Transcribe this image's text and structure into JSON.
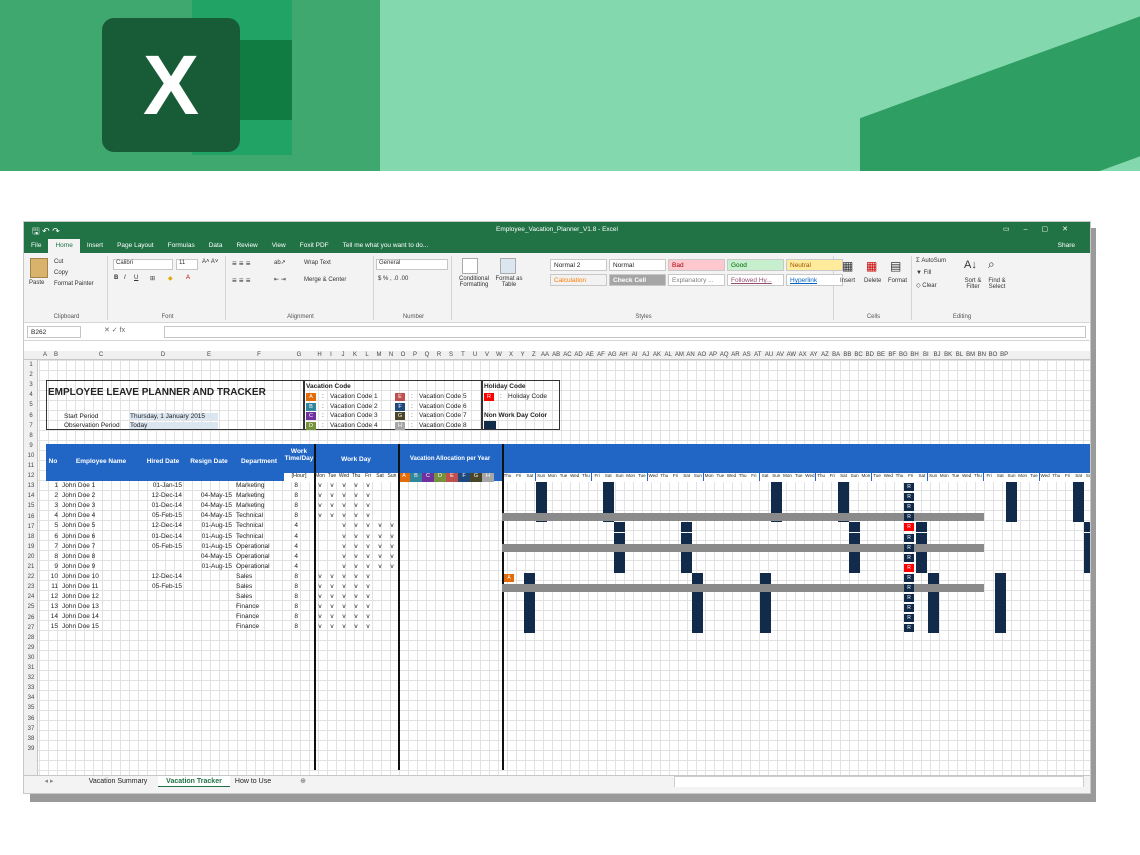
{
  "window": {
    "title": "Employee_Vacation_Planner_V1.8 - Excel",
    "share": "Share"
  },
  "tabs": [
    "File",
    "Home",
    "Insert",
    "Page Layout",
    "Formulas",
    "Data",
    "Review",
    "View",
    "Foxit PDF",
    "Tell me what you want to do..."
  ],
  "ribbon": {
    "clipboard": {
      "paste": "Paste",
      "cut": "Cut",
      "copy": "Copy",
      "format_painter": "Format Painter",
      "label": "Clipboard"
    },
    "font": {
      "name": "Calibri",
      "size": "11",
      "label": "Font"
    },
    "alignment": {
      "wrap": "Wrap Text",
      "merge": "Merge & Center",
      "label": "Alignment"
    },
    "number": {
      "format": "General",
      "label": "Number"
    },
    "styles": {
      "conditional": "Conditional Formatting",
      "format_table": "Format as Table",
      "label": "Styles",
      "cells": [
        {
          "text": "Normal 2",
          "bg": "#ffffff",
          "fg": "#222222"
        },
        {
          "text": "Normal",
          "bg": "#ffffff",
          "fg": "#222222"
        },
        {
          "text": "Bad",
          "bg": "#ffc7ce",
          "fg": "#9c0006"
        },
        {
          "text": "Good",
          "bg": "#c6efce",
          "fg": "#006100"
        },
        {
          "text": "Neutral",
          "bg": "#ffeb9c",
          "fg": "#9c5700"
        },
        {
          "text": "Calculation",
          "bg": "#f2f2f2",
          "fg": "#fa7d00"
        },
        {
          "text": "Check Cell",
          "bg": "#a5a5a5",
          "fg": "#ffffff"
        },
        {
          "text": "Explanatory ...",
          "bg": "#ffffff",
          "fg": "#7f7f7f"
        },
        {
          "text": "Followed Hy...",
          "bg": "#ffffff",
          "fg": "#954f72"
        },
        {
          "text": "Hyperlink",
          "bg": "#ffffff",
          "fg": "#0563c1"
        }
      ]
    },
    "cells_grp": {
      "insert": "Insert",
      "delete": "Delete",
      "format": "Format",
      "label": "Cells"
    },
    "editing": {
      "autosum": "AutoSum",
      "fill": "Fill",
      "clear": "Clear",
      "sort": "Sort & Filter",
      "find": "Find & Select",
      "label": "Editing"
    }
  },
  "namebox": "B262",
  "columns": [
    "A",
    "B",
    "C",
    "D",
    "E",
    "F",
    "G",
    "H",
    "I",
    "J",
    "K",
    "L",
    "M",
    "N",
    "O",
    "P",
    "Q",
    "R",
    "S",
    "T",
    "U",
    "V",
    "W",
    "X",
    "Y",
    "Z",
    "AA",
    "AB",
    "AC",
    "AD",
    "AE",
    "AF",
    "AG",
    "AH",
    "AI",
    "AJ",
    "AK",
    "AL",
    "AM",
    "AN",
    "AO",
    "AP",
    "AQ",
    "AR",
    "AS",
    "AT",
    "AU",
    "AV",
    "AW",
    "AX",
    "AY",
    "AZ",
    "BA",
    "BB",
    "BC",
    "BD",
    "BE",
    "BF",
    "BG",
    "BH",
    "BI",
    "BJ",
    "BK",
    "BL",
    "BM",
    "BN",
    "BO",
    "BP"
  ],
  "sheet": {
    "title": "EMPLOYEE LEAVE PLANNER AND TRACKER",
    "start_period_label": "Start Period",
    "start_period": "Thursday, 1 January 2015",
    "obs_period_label": "Observation Period",
    "obs_period": "Today",
    "vacation_code_title": "Vacation Code",
    "codes": [
      {
        "k": "A",
        "l": "Vacation Code 1",
        "c": "#e36c09"
      },
      {
        "k": "B",
        "l": "Vacation Code 2",
        "c": "#31859c"
      },
      {
        "k": "C",
        "l": "Vacation Code 3",
        "c": "#7030a0"
      },
      {
        "k": "D",
        "l": "Vacation Code 4",
        "c": "#76923c"
      },
      {
        "k": "E",
        "l": "Vacation Code 5",
        "c": "#c0504d"
      },
      {
        "k": "F",
        "l": "Vacation Code 6",
        "c": "#1f497d"
      },
      {
        "k": "G",
        "l": "Vacation Code 7",
        "c": "#494529"
      },
      {
        "k": "H",
        "l": "Vacation Code 8",
        "c": "#a6a6a6"
      }
    ],
    "holiday_code_title": "Holiday Code",
    "holiday_key": "R",
    "holiday_label": "Holiday Code",
    "nonwork_label": "Non Work Day Color",
    "headers": {
      "no": "No",
      "name": "Employee Name",
      "hired": "Hired Date",
      "resign": "Resign Date",
      "dept": "Department",
      "work": "Work Time/Day",
      "hour": "[Hour]",
      "workday": "Work Day",
      "alloc": "Vacation Allocation per Year"
    },
    "weekdays": [
      "Mon",
      "Tue",
      "Wed",
      "Thu",
      "Fri",
      "Sat",
      "Sun"
    ],
    "alloc_codes": [
      "A",
      "B",
      "C",
      "D",
      "E",
      "F",
      "G",
      "H"
    ],
    "employees": [
      {
        "no": "1",
        "name": "John Doe 1",
        "hired": "01-Jan-15",
        "resign": "",
        "dept": "Marketing",
        "hours": "8",
        "wd": "vvvvv.."
      },
      {
        "no": "2",
        "name": "John Doe 2",
        "hired": "12-Dec-14",
        "resign": "04-May-15",
        "dept": "Marketing",
        "hours": "8",
        "wd": "vvvvv.."
      },
      {
        "no": "3",
        "name": "John Doe 3",
        "hired": "01-Dec-14",
        "resign": "04-May-15",
        "dept": "Marketing",
        "hours": "8",
        "wd": "vvvvv.."
      },
      {
        "no": "4",
        "name": "John Doe 4",
        "hired": "05-Feb-15",
        "resign": "04-May-15",
        "dept": "Technical",
        "hours": "8",
        "wd": "vvvvv.."
      },
      {
        "no": "5",
        "name": "John Doe 5",
        "hired": "12-Dec-14",
        "resign": "01-Aug-15",
        "dept": "Technical",
        "hours": "4",
        "wd": "..vvvvv"
      },
      {
        "no": "6",
        "name": "John Doe 6",
        "hired": "01-Dec-14",
        "resign": "01-Aug-15",
        "dept": "Technical",
        "hours": "4",
        "wd": "..vvvvv"
      },
      {
        "no": "7",
        "name": "John Doe 7",
        "hired": "05-Feb-15",
        "resign": "01-Aug-15",
        "dept": "Operational",
        "hours": "4",
        "wd": "..vvvvv"
      },
      {
        "no": "8",
        "name": "John Doe 8",
        "hired": "",
        "resign": "04-May-15",
        "dept": "Operational",
        "hours": "4",
        "wd": "..vvvvv"
      },
      {
        "no": "9",
        "name": "John Doe 9",
        "hired": "",
        "resign": "01-Aug-15",
        "dept": "Operational",
        "hours": "4",
        "wd": "..vvvvv"
      },
      {
        "no": "10",
        "name": "John Doe 10",
        "hired": "12-Dec-14",
        "resign": "",
        "dept": "Sales",
        "hours": "8",
        "wd": "vvvvv.."
      },
      {
        "no": "11",
        "name": "John Doe 11",
        "hired": "05-Feb-15",
        "resign": "",
        "dept": "Sales",
        "hours": "8",
        "wd": "vvvvv.."
      },
      {
        "no": "12",
        "name": "John Doe 12",
        "hired": "",
        "resign": "",
        "dept": "Sales",
        "hours": "8",
        "wd": "vvvvv.."
      },
      {
        "no": "13",
        "name": "John Doe 13",
        "hired": "",
        "resign": "",
        "dept": "Finance",
        "hours": "8",
        "wd": "vvvvv.."
      },
      {
        "no": "14",
        "name": "John Doe 14",
        "hired": "",
        "resign": "",
        "dept": "Finance",
        "hours": "8",
        "wd": "vvvvv.."
      },
      {
        "no": "15",
        "name": "John Doe 15",
        "hired": "",
        "resign": "",
        "dept": "Finance",
        "hours": "8",
        "wd": "vvvvv.."
      }
    ],
    "cal_days": [
      "Thu",
      "Fri",
      "Sat",
      "Sun",
      "Mon",
      "Tue",
      "Wed",
      "Thu",
      "Fri",
      "Sat",
      "Sun",
      "Mon",
      "Tue",
      "Wed",
      "Thu",
      "Fri",
      "Sat",
      "Sun",
      "Mon",
      "Tue",
      "Wed",
      "Thu",
      "Fri",
      "Sat",
      "Sun",
      "Mon",
      "Tue",
      "Wed",
      "Thu",
      "Fri",
      "Sat",
      "Sun",
      "Mon",
      "Tue",
      "Wed",
      "Thu",
      "Fri",
      "Sat",
      "Sun",
      "Mon",
      "Tue",
      "Wed",
      "Thu",
      "Fri",
      "Sat",
      "Sun",
      "Mon",
      "Tue",
      "Wed",
      "Thu",
      "Fri",
      "Sat",
      "Sun",
      "Mon",
      "Tue",
      "Wed",
      "Thu",
      "Fri",
      "Sat",
      "Sun",
      "Mon",
      "Tue",
      "Wed",
      "Thu",
      "Fri",
      "Sat"
    ]
  },
  "sheet_tabs": [
    "Vacation Summary",
    "Vacation Tracker",
    "How to Use"
  ],
  "active_sheet": "Vacation Tracker"
}
